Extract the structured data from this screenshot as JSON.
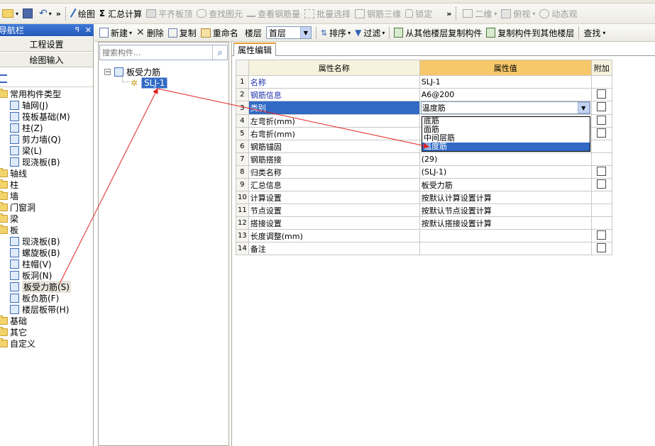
{
  "top_toolbar": {
    "buttons": [
      {
        "label": "绘图",
        "icon": "pencil-icon"
      },
      {
        "label": "汇总计算",
        "icon": "sigma-icon"
      },
      {
        "label": "平齐板顶",
        "icon": "align-top-icon"
      },
      {
        "label": "查找图元",
        "icon": "binoculars-icon"
      },
      {
        "label": "查看钢筋量",
        "icon": "view-rebar-icon"
      },
      {
        "label": "批量选择",
        "icon": "batch-select-icon"
      },
      {
        "label": "钢筋三维",
        "icon": "rebar-3d-icon"
      },
      {
        "label": "锁定",
        "icon": "lock-icon"
      }
    ],
    "view_2d": "二维",
    "view_top": "俯视",
    "dynamic": "动态观"
  },
  "nav_panel": {
    "title": "导航栏",
    "pin": "ꟼ",
    "close": "✕",
    "buttons": [
      "工程设置",
      "绘图输入"
    ],
    "tree": [
      {
        "label": "常用构件类型",
        "level": 0,
        "type": "folder"
      },
      {
        "label": "轴网(J)",
        "level": 1,
        "type": "item"
      },
      {
        "label": "筏板基础(M)",
        "level": 1,
        "type": "item"
      },
      {
        "label": "柱(Z)",
        "level": 1,
        "type": "item"
      },
      {
        "label": "剪力墙(Q)",
        "level": 1,
        "type": "item"
      },
      {
        "label": "梁(L)",
        "level": 1,
        "type": "item"
      },
      {
        "label": "现浇板(B)",
        "level": 1,
        "type": "item"
      },
      {
        "label": "轴线",
        "level": 0,
        "type": "folder"
      },
      {
        "label": "柱",
        "level": 0,
        "type": "folder"
      },
      {
        "label": "墙",
        "level": 0,
        "type": "folder"
      },
      {
        "label": "门窗洞",
        "level": 0,
        "type": "folder"
      },
      {
        "label": "梁",
        "level": 0,
        "type": "folder"
      },
      {
        "label": "板",
        "level": 0,
        "type": "folder"
      },
      {
        "label": "现浇板(B)",
        "level": 1,
        "type": "item"
      },
      {
        "label": "螺旋板(B)",
        "level": 1,
        "type": "item"
      },
      {
        "label": "柱帽(V)",
        "level": 1,
        "type": "item"
      },
      {
        "label": "板洞(N)",
        "level": 1,
        "type": "item"
      },
      {
        "label": "板受力筋(S)",
        "level": 1,
        "type": "item",
        "selected": true
      },
      {
        "label": "板负筋(F)",
        "level": 1,
        "type": "item"
      },
      {
        "label": "楼层板带(H)",
        "level": 1,
        "type": "item"
      },
      {
        "label": "基础",
        "level": 0,
        "type": "folder"
      },
      {
        "label": "其它",
        "level": 0,
        "type": "folder"
      },
      {
        "label": "自定义",
        "level": 0,
        "type": "folder"
      }
    ]
  },
  "sub_toolbar": {
    "new": "新建",
    "delete": "删除",
    "copy": "复制",
    "rename": "重命名",
    "floor_label": "楼层",
    "floor_value": "首层",
    "sort": "排序",
    "filter": "过滤",
    "copy_from": "从其他楼层复制构件",
    "copy_to": "复制构件到其他楼层",
    "find": "查找"
  },
  "component_panel": {
    "search_placeholder": "搜索构件...",
    "root": "板受力筋",
    "child": "SLJ-1"
  },
  "property_tab": "属性编辑",
  "property_table": {
    "headers": [
      "属性名称",
      "属性值",
      "附加"
    ],
    "rows": [
      {
        "n": "1",
        "name": "名称",
        "value": "SLJ-1",
        "blue": true,
        "check": false
      },
      {
        "n": "2",
        "name": "钢筋信息",
        "value": "A6@200",
        "blue": true,
        "check": true
      },
      {
        "n": "3",
        "name": "类别",
        "value": "温度筋",
        "blue": true,
        "check": true,
        "selected": true
      },
      {
        "n": "4",
        "name": "左弯折(mm)",
        "value": "",
        "blue": false,
        "check": true
      },
      {
        "n": "5",
        "name": "右弯折(mm)",
        "value": "",
        "blue": false,
        "check": true
      },
      {
        "n": "6",
        "name": "钢筋锚固",
        "value": "",
        "blue": false,
        "check": false
      },
      {
        "n": "7",
        "name": "钢筋搭接",
        "value": "(29)",
        "blue": false,
        "check": false
      },
      {
        "n": "8",
        "name": "归类名称",
        "value": "(SLJ-1)",
        "blue": false,
        "check": true
      },
      {
        "n": "9",
        "name": "汇总信息",
        "value": "板受力筋",
        "blue": false,
        "check": true
      },
      {
        "n": "10",
        "name": "计算设置",
        "value": "按默认计算设置计算",
        "blue": false,
        "check": false
      },
      {
        "n": "11",
        "name": "节点设置",
        "value": "按默认节点设置计算",
        "blue": false,
        "check": false
      },
      {
        "n": "12",
        "name": "搭接设置",
        "value": "按默认搭接设置计算",
        "blue": false,
        "check": false
      },
      {
        "n": "13",
        "name": "长度调整(mm)",
        "value": "",
        "blue": false,
        "check": true
      },
      {
        "n": "14",
        "name": "备注",
        "value": "",
        "blue": false,
        "check": true
      }
    ]
  },
  "dropdown": {
    "options": [
      "底筋",
      "面筋",
      "中间层筋",
      "温度筋"
    ],
    "selected": "温度筋"
  },
  "colors": {
    "selection": "#316ac5",
    "header_value": "#f6c86a",
    "arrow": "#e02020"
  }
}
